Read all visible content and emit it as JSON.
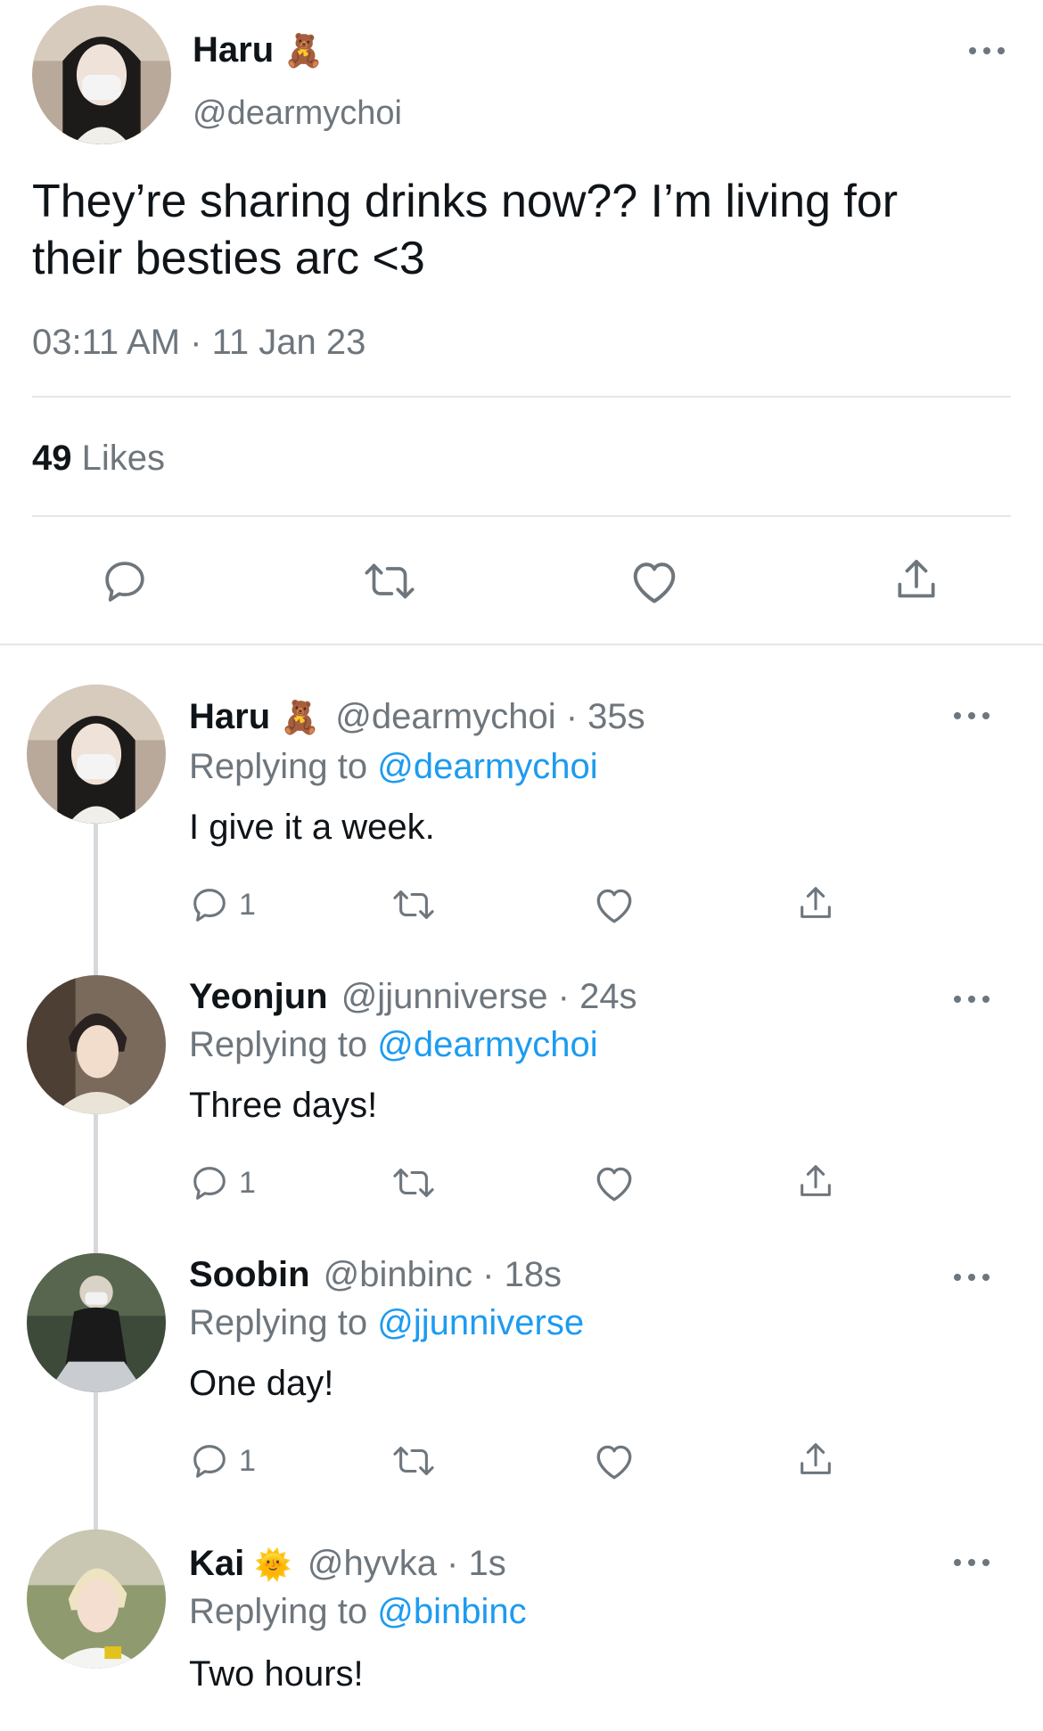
{
  "main_tweet": {
    "name": "Haru",
    "emoji": "🧸",
    "handle": "@dearmychoi",
    "text_line1": "They’re sharing drinks now?? I’m living for",
    "text_line2": "their besties arc <3",
    "time": "03:11 AM · 11 Jan 23",
    "likes_count": "49",
    "likes_label": "Likes"
  },
  "replies": [
    {
      "name": "Haru",
      "emoji": "🧸",
      "handle_time": "@dearmychoi · 35s",
      "replying_prefix": "Replying to",
      "replying_to": "@dearmychoi",
      "text": "I give it a week.",
      "reply_count": "1"
    },
    {
      "name": "Yeonjun",
      "emoji": "",
      "handle_time": "@jjunniverse · 24s",
      "replying_prefix": "Replying to",
      "replying_to": "@dearmychoi",
      "text": "Three days!",
      "reply_count": "1"
    },
    {
      "name": "Soobin",
      "emoji": "",
      "handle_time": "@binbinc · 18s",
      "replying_prefix": "Replying to",
      "replying_to": "@jjunniverse",
      "text": "One day!",
      "reply_count": "1"
    },
    {
      "name": "Kai",
      "emoji": "🌞",
      "handle_time": "@hyvka · 1s",
      "replying_prefix": "Replying to",
      "replying_to": "@binbinc",
      "text": "Two hours!"
    }
  ],
  "colors": {
    "link": "#1d9bf0",
    "muted": "#6e767d",
    "text": "#0f1419"
  },
  "icons": [
    "reply-icon",
    "retweet-icon",
    "heart-icon",
    "share-icon",
    "more-icon",
    "avatar"
  ]
}
